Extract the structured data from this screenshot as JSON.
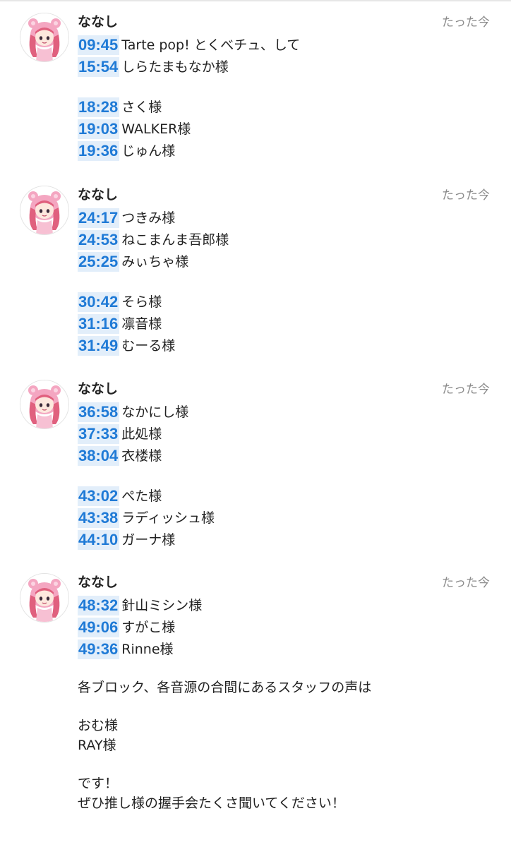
{
  "posts": [
    {
      "user": "ななし",
      "time": "たった今",
      "groups": [
        [
          {
            "ts": "09:45",
            "label": "Tarte pop! とくべチュ、して"
          },
          {
            "ts": "15:54",
            "label": "しらたまもなか様"
          }
        ],
        [
          {
            "ts": "18:28",
            "label": "さく様"
          },
          {
            "ts": "19:03",
            "label": "WALKER様"
          },
          {
            "ts": "19:36",
            "label": "じゅん様"
          }
        ]
      ]
    },
    {
      "user": "ななし",
      "time": "たった今",
      "groups": [
        [
          {
            "ts": "24:17",
            "label": "つきみ様"
          },
          {
            "ts": "24:53",
            "label": "ねこまんま吾郎様"
          },
          {
            "ts": "25:25",
            "label": "みぃちゃ様"
          }
        ],
        [
          {
            "ts": "30:42",
            "label": "そら様"
          },
          {
            "ts": "31:16",
            "label": "凛音様"
          },
          {
            "ts": "31:49",
            "label": "むーる様"
          }
        ]
      ]
    },
    {
      "user": "ななし",
      "time": "たった今",
      "groups": [
        [
          {
            "ts": "36:58",
            "label": "なかにし様"
          },
          {
            "ts": "37:33",
            "label": "此処様"
          },
          {
            "ts": "38:04",
            "label": "衣楼様"
          }
        ],
        [
          {
            "ts": "43:02",
            "label": "ぺた様"
          },
          {
            "ts": "43:38",
            "label": "ラディッシュ様"
          },
          {
            "ts": "44:10",
            "label": "ガーナ様"
          }
        ]
      ]
    },
    {
      "user": "ななし",
      "time": "たった今",
      "groups": [
        [
          {
            "ts": "48:32",
            "label": "針山ミシン様"
          },
          {
            "ts": "49:06",
            "label": "すがこ様"
          },
          {
            "ts": "49:36",
            "label": "Rinne様"
          }
        ]
      ],
      "notes": {
        "staff_intro": "各ブロック、各音源の合間にあるスタッフの声は",
        "staff_1": "おむ様",
        "staff_2": "RAY様",
        "closing_1": "です！",
        "closing_2": "ぜひ推し様の握手会たくさ聞いてください！"
      }
    }
  ],
  "colors": {
    "timestamp_text": "#1f7ad6",
    "timestamp_highlight": "#e2eefa",
    "time_gray": "#8a8a8a",
    "avatar_pink": "#f4a6c1"
  },
  "icons": {
    "avatar": "avatar-pink-bear-hood-girl"
  }
}
